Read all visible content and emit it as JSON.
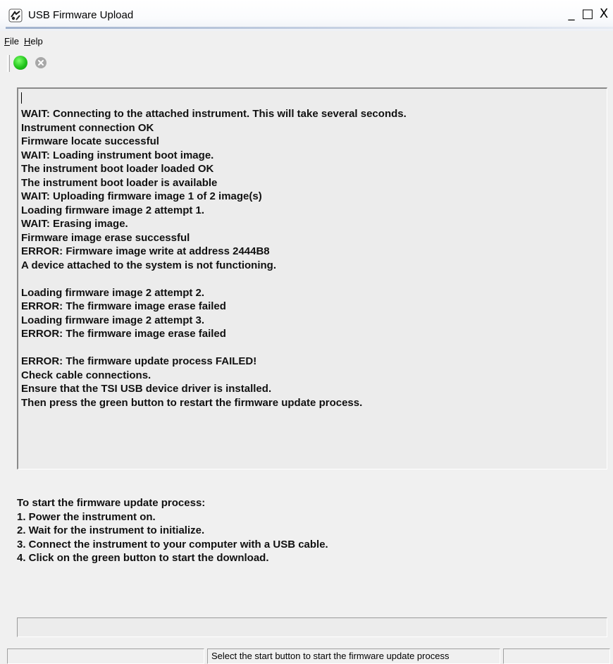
{
  "window": {
    "title": "USB Firmware Upload",
    "icon": "usb-upload-app-icon",
    "controls": {
      "minimize": "_",
      "maximize": "□",
      "close": "X"
    }
  },
  "menu": {
    "file": {
      "mnemonic": "F",
      "rest": "ile"
    },
    "help": {
      "mnemonic": "H",
      "rest": "elp"
    }
  },
  "toolbar": {
    "start_icon": "green-circle-icon",
    "stop_icon": "gray-x-circle-icon"
  },
  "log": {
    "lines": [
      "WAIT: Connecting to the attached instrument. This will take several seconds.",
      "Instrument connection OK",
      "Firmware locate successful",
      "WAIT: Loading instrument boot image.",
      "The instrument boot loader loaded OK",
      "The instrument boot loader is available",
      "WAIT: Uploading firmware image 1 of 2 image(s)",
      "Loading firmware image 2 attempt 1.",
      "WAIT: Erasing image.",
      "Firmware image erase successful",
      "ERROR: Firmware image write at address 2444B8",
      "A device attached to the system is not functioning.",
      "",
      "Loading firmware image 2 attempt 2.",
      "ERROR: The firmware image erase failed",
      "Loading firmware image 2 attempt 3.",
      "ERROR: The firmware image erase failed",
      "",
      "ERROR: The firmware update process FAILED!",
      "Check cable connections.",
      "Ensure that the TSI USB device driver is installed.",
      "Then press the green button to restart the firmware update process."
    ]
  },
  "instructions": {
    "lines": [
      "To start the firmware update process:",
      "1. Power the instrument on.",
      "2. Wait for the instrument to initialize.",
      "3. Connect the instrument to your computer with a USB cable.",
      "4. Click on the green button to start the download."
    ]
  },
  "progress": {
    "fraction": 0
  },
  "status": {
    "message": "Select the start button to start the firmware update process",
    "secondary": ""
  },
  "colors": {
    "start_green": "#22c51b",
    "stop_gray": "#a8a8a8",
    "panel_bg": "#ececec",
    "window_bg": "#f0f0f0"
  }
}
